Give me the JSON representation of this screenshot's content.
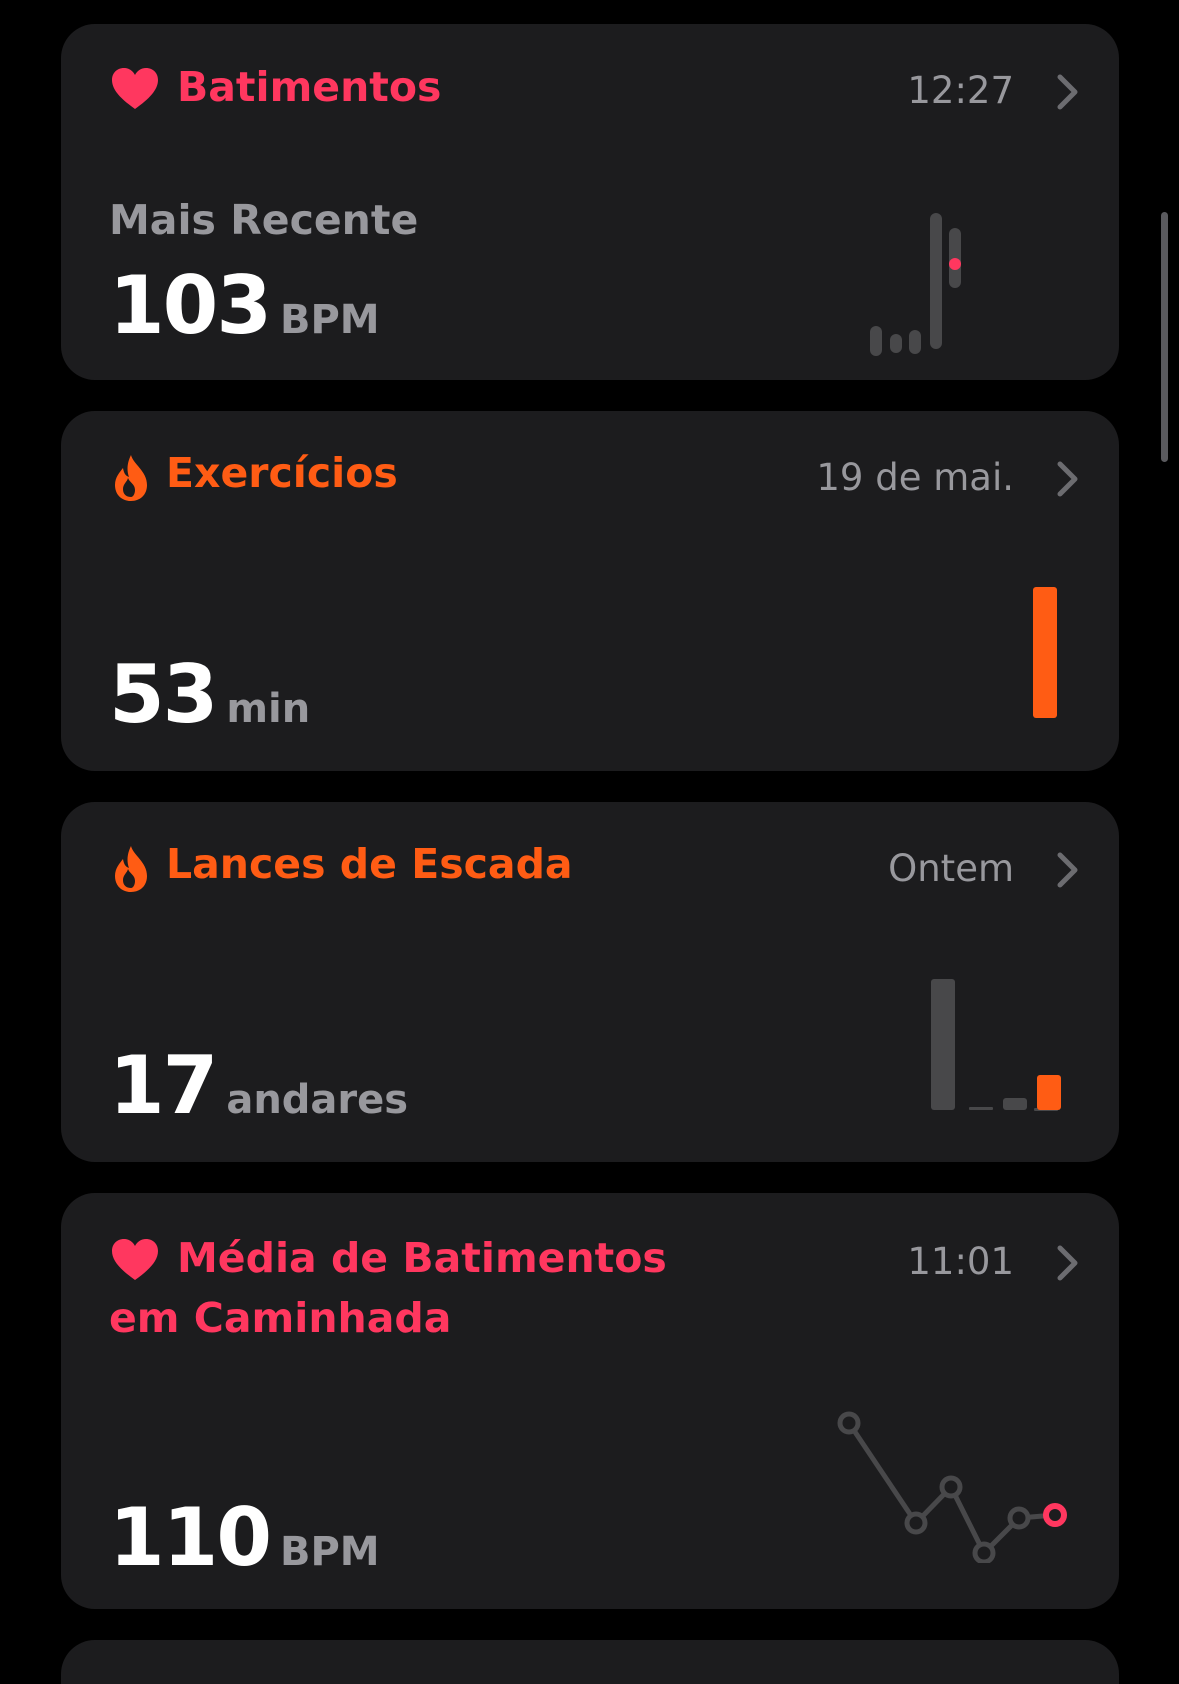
{
  "colors": {
    "heart": "#ff375f",
    "activity": "#ff5c14",
    "card": "#1c1c1e",
    "secondary": "#98989d",
    "muted_bar": "#48484a"
  },
  "cards": [
    {
      "icon": "heart-icon",
      "title": "Batimentos",
      "meta": "12:27",
      "subtitle": "Mais Recente",
      "value": "103",
      "unit": "BPM"
    },
    {
      "icon": "flame-icon",
      "title": "Exercícios",
      "meta": "19 de mai.",
      "value": "53",
      "unit": "min"
    },
    {
      "icon": "flame-icon",
      "title": "Lances de Escada",
      "meta": "Ontem",
      "value": "17",
      "unit": "andares"
    },
    {
      "icon": "heart-icon",
      "title_line1": "Média de Batimentos",
      "title_line2": "em Caminhada",
      "meta": "11:01",
      "value": "110",
      "unit": "BPM"
    }
  ]
}
